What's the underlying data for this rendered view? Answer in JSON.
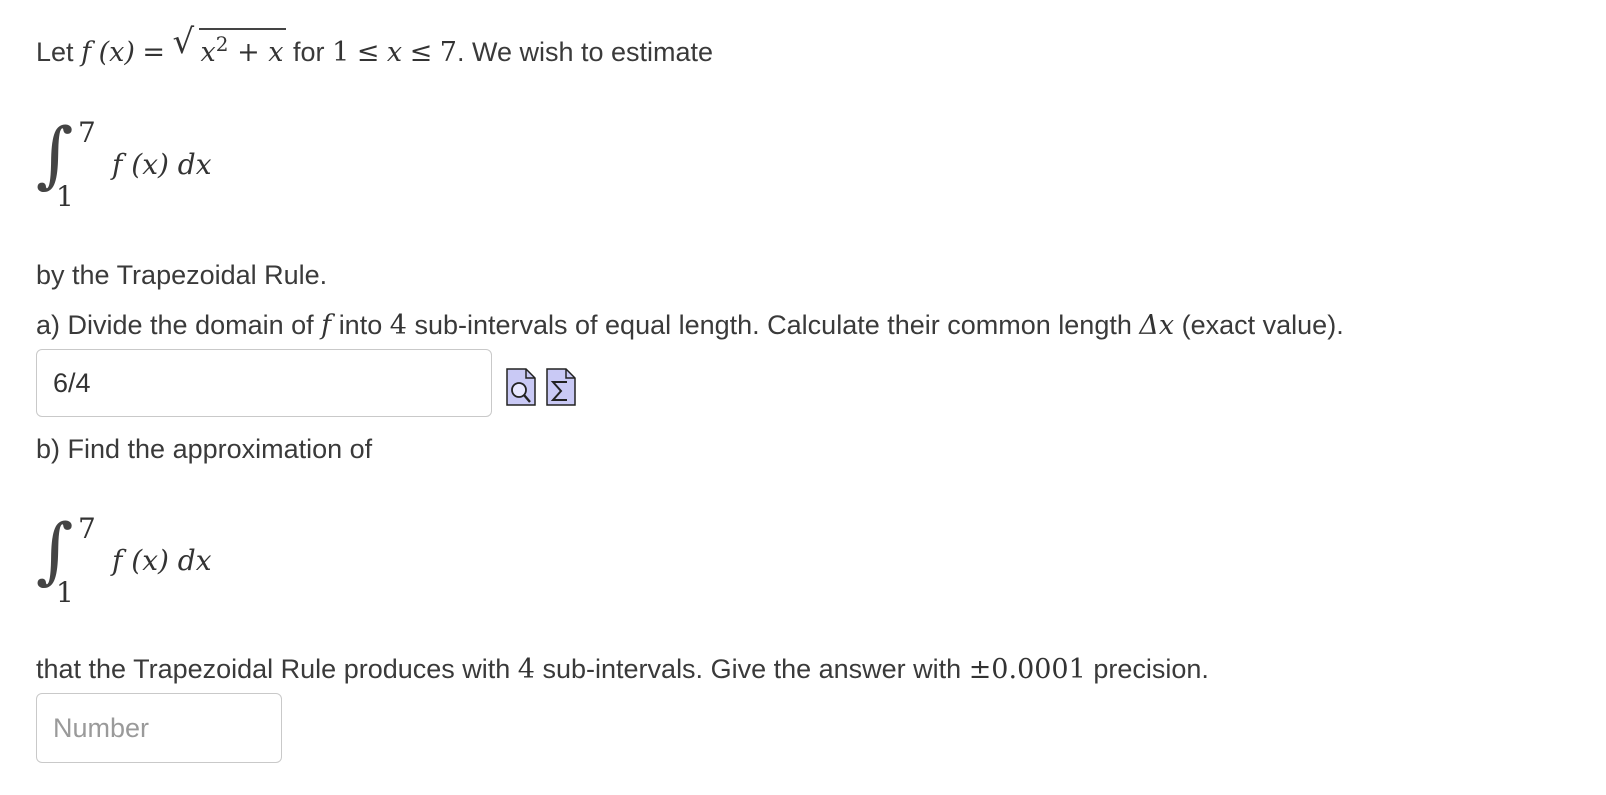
{
  "problem": {
    "intro_let": "Let",
    "intro_f": "f",
    "intro_x_paren": "(x)",
    "intro_eq": "=",
    "intro_sqrt_body": "x2 + x",
    "intro_sqrt_base": "x",
    "intro_sqrt_exp": "2",
    "intro_sqrt_rest": " + x",
    "intro_for": "for",
    "intro_lower": "1",
    "intro_le1": "≤",
    "intro_var": "x",
    "intro_le2": "≤",
    "intro_upper": "7",
    "intro_tail": ". We wish to estimate",
    "integral": {
      "upper": "7",
      "lower": "1",
      "integrand": "f (x) dx"
    },
    "method_line": "by the Trapezoidal Rule."
  },
  "part_a": {
    "prefix": "a) Divide the domain of",
    "f": "f",
    "into": "into",
    "n": "4",
    "mid": "sub-intervals of equal length. Calculate their common length",
    "delta": "Δx",
    "suffix": "(exact value).",
    "answer_value": "6/4",
    "preview_icon": "preview-magnifier-icon",
    "equation_icon": "equation-editor-sigma-icon"
  },
  "part_b": {
    "prefix": "b) Find the approximation of",
    "integral": {
      "upper": "7",
      "lower": "1",
      "integrand": "f (x) dx"
    },
    "line_pre": "that the Trapezoidal Rule produces with",
    "n": "4",
    "line_mid": "sub-intervals. Give the answer with",
    "precision": "±0.0001",
    "line_post": "precision.",
    "answer_placeholder": "Number"
  },
  "colors": {
    "text": "#3a3a3a",
    "input_border": "#c9c9c9",
    "icon_fill": "#c9c9f5"
  }
}
